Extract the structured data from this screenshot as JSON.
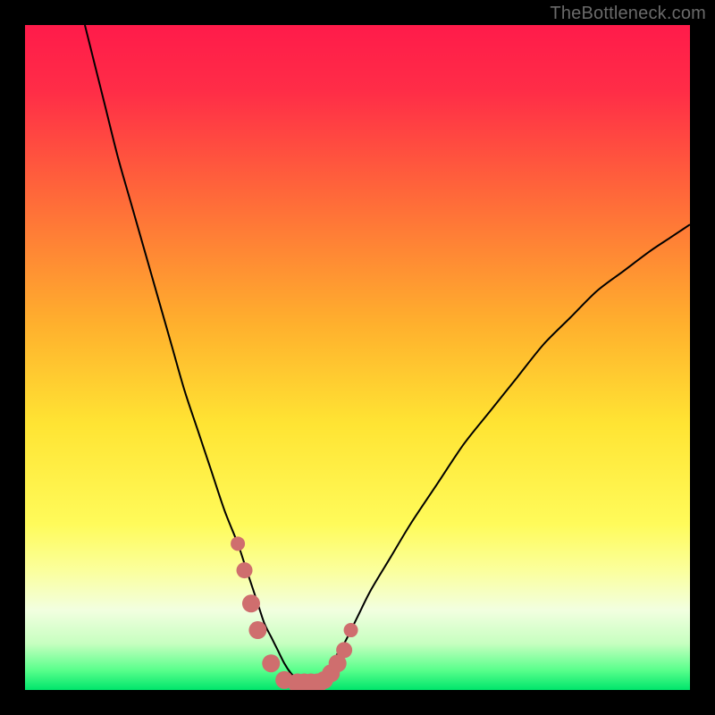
{
  "watermark": "TheBottleneck.com",
  "colors": {
    "frame": "#000000",
    "curve_stroke": "#000000",
    "marker_fill": "#cf6e6e",
    "gradient_stops": [
      {
        "offset": 0.0,
        "color": "#ff1b4a"
      },
      {
        "offset": 0.1,
        "color": "#ff2d47"
      },
      {
        "offset": 0.25,
        "color": "#ff663a"
      },
      {
        "offset": 0.45,
        "color": "#ffb02d"
      },
      {
        "offset": 0.6,
        "color": "#ffe433"
      },
      {
        "offset": 0.75,
        "color": "#fffb5a"
      },
      {
        "offset": 0.82,
        "color": "#fbff9c"
      },
      {
        "offset": 0.88,
        "color": "#f2ffe0"
      },
      {
        "offset": 0.93,
        "color": "#c7ffc0"
      },
      {
        "offset": 0.97,
        "color": "#5aff8c"
      },
      {
        "offset": 1.0,
        "color": "#00e56b"
      }
    ]
  },
  "chart_data": {
    "type": "line",
    "title": "",
    "xlabel": "",
    "ylabel": "",
    "xlim": [
      0,
      100
    ],
    "ylim": [
      0,
      100
    ],
    "series": [
      {
        "name": "bottleneck-curve",
        "x": [
          9,
          10,
          12,
          14,
          16,
          18,
          20,
          22,
          24,
          26,
          28,
          30,
          32,
          33,
          34,
          35,
          36,
          37,
          38,
          39,
          40,
          41,
          42,
          43,
          44,
          45,
          46,
          48,
          50,
          52,
          55,
          58,
          62,
          66,
          70,
          74,
          78,
          82,
          86,
          90,
          94,
          97,
          100
        ],
        "y": [
          100,
          96,
          88,
          80,
          73,
          66,
          59,
          52,
          45,
          39,
          33,
          27,
          22,
          19,
          16,
          13,
          10,
          8,
          6,
          4,
          2.5,
          1.5,
          1,
          1,
          1.5,
          2.5,
          4,
          7,
          11,
          15,
          20,
          25,
          31,
          37,
          42,
          47,
          52,
          56,
          60,
          63,
          66,
          68,
          70
        ]
      }
    ],
    "markers": {
      "name": "highlight-points",
      "x": [
        32,
        33,
        34,
        35,
        37,
        39,
        41,
        42,
        43,
        44,
        45,
        46,
        47,
        48,
        49
      ],
      "y": [
        22,
        18,
        13,
        9,
        4,
        1.5,
        1,
        1,
        1,
        1,
        1.5,
        2.5,
        4,
        6,
        9
      ],
      "r": [
        8,
        9,
        10,
        10,
        10,
        10,
        11,
        11,
        11,
        11,
        10,
        10,
        10,
        9,
        8
      ]
    }
  }
}
